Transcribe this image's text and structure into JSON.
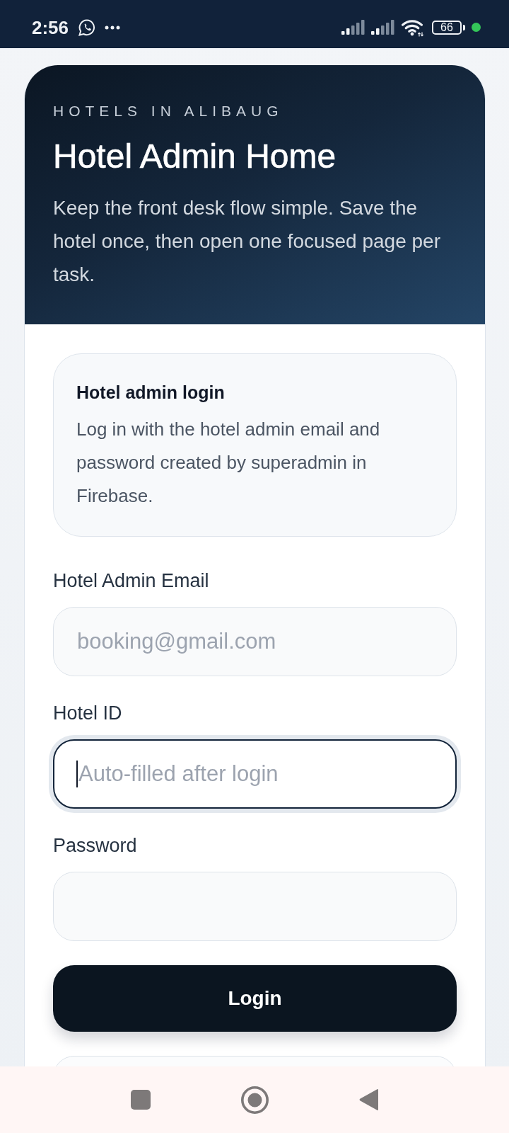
{
  "status_bar": {
    "time": "2:56",
    "battery": "66"
  },
  "hero": {
    "eyebrow": "HOTELS IN ALIBAUG",
    "title": "Hotel Admin Home",
    "description": "Keep the front desk flow simple. Save the hotel once, then open one focused page per task."
  },
  "login_panel": {
    "title": "Hotel admin login",
    "description": "Log in with the hotel admin email and password created by superadmin in Firebase."
  },
  "fields": [
    {
      "label": "Hotel Admin Email",
      "placeholder": "booking@gmail.com",
      "focused": false
    },
    {
      "label": "Hotel ID",
      "placeholder": "Auto-filled after login",
      "focused": true
    },
    {
      "label": "Password",
      "focused": false
    }
  ],
  "login_button": {
    "label": "Login"
  }
}
